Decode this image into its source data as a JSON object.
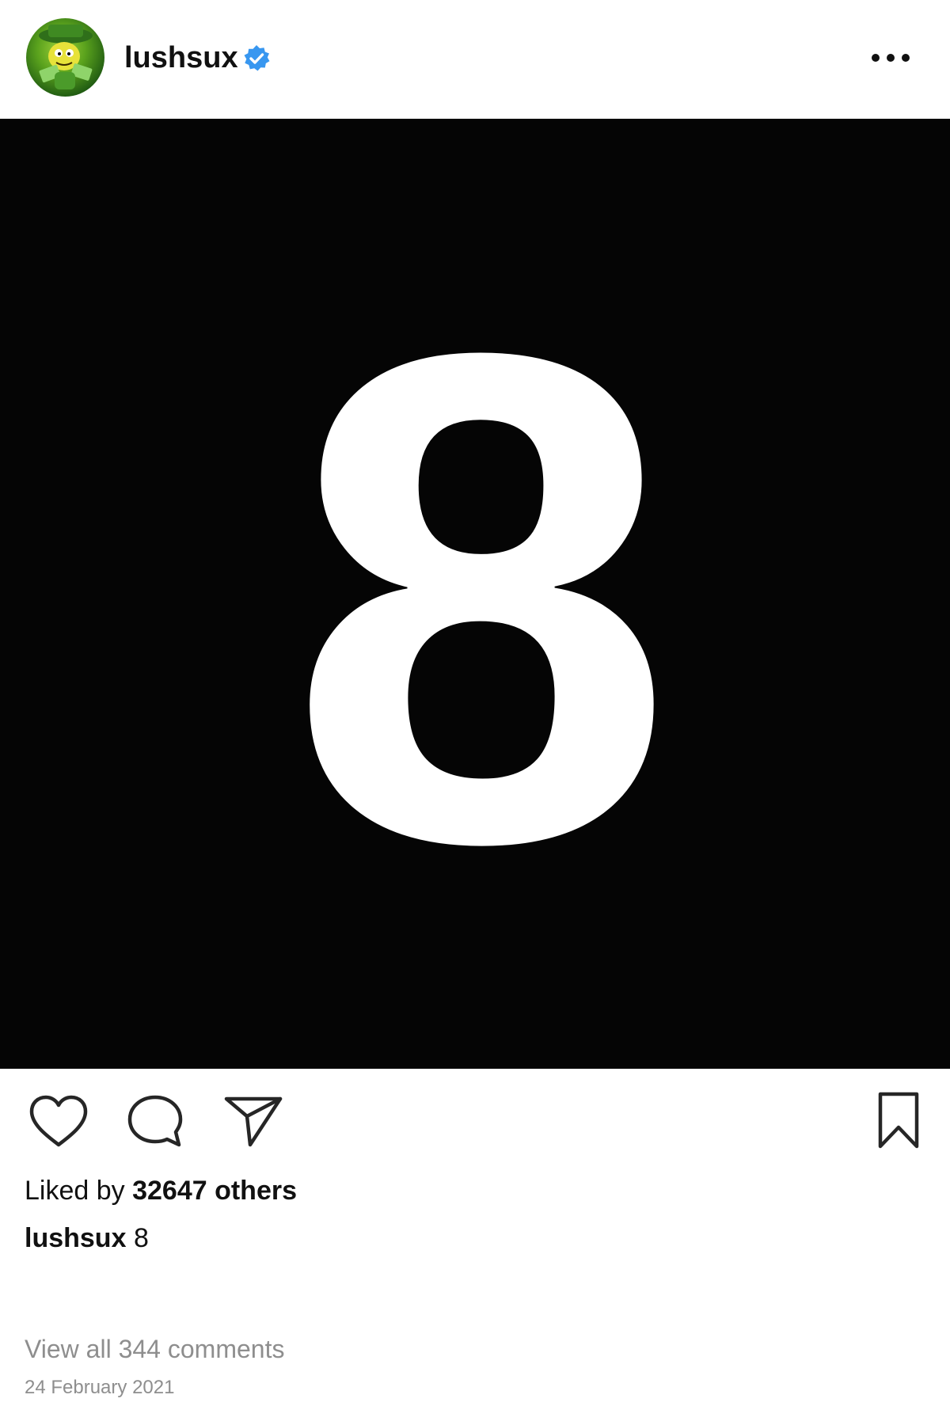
{
  "header": {
    "username": "lushsux",
    "avatar_icon": "cartoon-character-avatar-icon",
    "verified_icon": "verified-badge-icon",
    "more_icon": "more-options-icon"
  },
  "post": {
    "image_text": "8",
    "image_background": "#050505",
    "image_foreground": "#ffffff"
  },
  "actions": {
    "like_icon": "heart-icon",
    "comment_icon": "comment-bubble-icon",
    "share_icon": "paper-plane-icon",
    "save_icon": "bookmark-icon"
  },
  "likes": {
    "prefix": "Liked by",
    "count_text": "32647 others"
  },
  "caption": {
    "username": "lushsux",
    "text": "8"
  },
  "comments": {
    "view_all": "View all 344 comments"
  },
  "date": "24 February 2021",
  "colors": {
    "verified": "#3897f0",
    "muted_text": "#8e8e8e",
    "text": "#111111"
  }
}
